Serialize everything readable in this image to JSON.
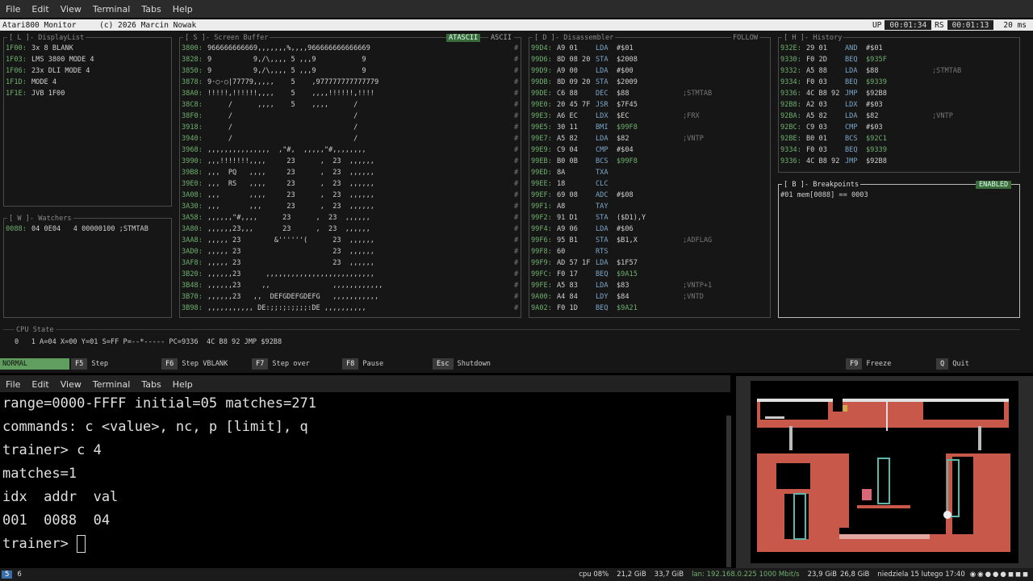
{
  "top_menu": [
    "File",
    "Edit",
    "View",
    "Terminal",
    "Tabs",
    "Help"
  ],
  "title": {
    "app": "Atari800 Monitor",
    "copyright": "(c) 2026 Marcin Nowak",
    "up_label": "UP",
    "up_value": "00:01:34",
    "rs_label": "RS",
    "rs_value": "00:01:13",
    "ms": "20 ms"
  },
  "displaylist": {
    "title": "[ L ]- DisplayList",
    "rows": [
      [
        "1F00:",
        "3x 8 BLANK"
      ],
      [
        "1F03:",
        "LMS 3800 MODE 4"
      ],
      [
        "1F06:",
        "23x DLI MODE 4"
      ],
      [
        "1F1D:",
        "MODE 4"
      ],
      [
        "1F1E:",
        "JVB 1F00"
      ]
    ]
  },
  "watchers": {
    "title": "[ W ]- Watchers",
    "rows": [
      [
        "0088:",
        "04 0E04   4 00000100 ;STMTAB"
      ]
    ]
  },
  "screen": {
    "title": "[ S ]- Screen Buffer",
    "tab_active": "ATASCII",
    "tab_other": "ASCII",
    "rows": [
      [
        "3800:",
        "966666666669,,,,,,,%,,,,966666666666669"
      ],
      [
        "3828:",
        "9          9,/\\,,,, 5 ,,,9           9"
      ],
      [
        "3850:",
        "9          9,/\\,,,, 5 ,,,9           9"
      ],
      [
        "3878:",
        "9·○·○|77779,,,,,    5    ,977777777777779"
      ],
      [
        "38A0:",
        "!!!!!,!!!!!!,,,,    5    ,,,,!!!!!!,!!!!"
      ],
      [
        "38C8:",
        "     /      ,,,,    5    ,,,,      /"
      ],
      [
        "38F0:",
        "     /                             /"
      ],
      [
        "3918:",
        "     /                             /"
      ],
      [
        "3940:",
        "     /                             /"
      ],
      [
        "3968:",
        ",,,,,,,,,,,,,,,  ,\"#,  ,,,,,\"#,,,,,,,,"
      ],
      [
        "3990:",
        ",,,!!!!!!!,,,,     23      ,  23  ,,,,,,"
      ],
      [
        "39B8:",
        ",,,  PQ   ,,,,     23      ,  23  ,,,,,,"
      ],
      [
        "39E0:",
        ",,,  RS   ,,,,     23      ,  23  ,,,,,,"
      ],
      [
        "3A08:",
        ",,,       ,,,,     23      ,  23  ,,,,,,"
      ],
      [
        "3A30:",
        ",,,       ,,,      23      ,  23  ,,,,,,"
      ],
      [
        "3A58:",
        ",,,,,,\"#,,,,      23      ,  23  ,,,,,,"
      ],
      [
        "3A80:",
        ",,,,,,23,,,       23      ,  23  ,,,,,,"
      ],
      [
        "3AA8:",
        ",,,,, 23        &''''''(      23  ,,,,,,"
      ],
      [
        "3AD0:",
        ",,,,, 23                      23  ,,,,,,"
      ],
      [
        "3AF8:",
        ",,,,, 23                      23  ,,,,,,"
      ],
      [
        "3B20:",
        ",,,,,,23      ,,,,,,,,,,,,,,,,,,,,,,,,,,"
      ],
      [
        "3B48:",
        ",,,,,,23     ,,               ,,,,,,,,,,,,"
      ],
      [
        "3B70:",
        ",,,,,,23   ,,  DEFGDEFGDEFG   ,,,,,,,,,,,"
      ],
      [
        "3B98:",
        ",,,,,,,,,,, DE:;;:;:;;;;:DE ,,,,,,,,,,"
      ]
    ]
  },
  "disasm": {
    "title": "[ D ]- Disassembler",
    "follow": "FOLLOW",
    "rows": [
      [
        "99D4:",
        "A9 01",
        "LDA",
        "#$01",
        ""
      ],
      [
        "99D6:",
        "8D 08 20",
        "STA",
        "$2008",
        ""
      ],
      [
        "99D9:",
        "A9 00",
        "LDA",
        "#$00",
        ""
      ],
      [
        "99DB:",
        "8D 09 20",
        "STA",
        "$2009",
        ""
      ],
      [
        "99DE:",
        "C6 88",
        "DEC",
        "$88",
        ";STMTAB"
      ],
      [
        "99E0:",
        "20 45 7F",
        "JSR",
        "$7F45",
        ""
      ],
      [
        "99E3:",
        "A6 EC",
        "LDX",
        "$EC",
        ";FRX"
      ],
      [
        "99E5:",
        "30 11",
        "BMI",
        "$99F8",
        ""
      ],
      [
        "99E7:",
        "A5 82",
        "LDA",
        "$82",
        ";VNTP"
      ],
      [
        "99E9:",
        "C9 04",
        "CMP",
        "#$04",
        ""
      ],
      [
        "99EB:",
        "B0 0B",
        "BCS",
        "$99F8",
        ""
      ],
      [
        "99ED:",
        "8A",
        "TXA",
        "",
        ""
      ],
      [
        "99EE:",
        "18",
        "CLC",
        "",
        ""
      ],
      [
        "99EF:",
        "69 08",
        "ADC",
        "#$08",
        ""
      ],
      [
        "99F1:",
        "A8",
        "TAY",
        "",
        ""
      ],
      [
        "99F2:",
        "91 D1",
        "STA",
        "($D1),Y",
        ""
      ],
      [
        "99F4:",
        "A9 06",
        "LDA",
        "#$06",
        ""
      ],
      [
        "99F6:",
        "95 B1",
        "STA",
        "$B1,X",
        ";ADFLAG"
      ],
      [
        "99F8:",
        "60",
        "RTS",
        "",
        ""
      ],
      [
        "99F9:",
        "AD 57 1F",
        "LDA",
        "$1F57",
        ""
      ],
      [
        "99FC:",
        "F0 17",
        "BEQ",
        "$9A15",
        ""
      ],
      [
        "99FE:",
        "A5 83",
        "LDA",
        "$83",
        ";VNTP+1"
      ],
      [
        "9A00:",
        "A4 84",
        "LDY",
        "$84",
        ";VNTD"
      ],
      [
        "9A02:",
        "F0 1D",
        "BEQ",
        "$9A21",
        ""
      ]
    ]
  },
  "history": {
    "title": "[ H ]- History",
    "rows": [
      [
        "932E:",
        "29 01",
        "AND",
        "#$01",
        ""
      ],
      [
        "9330:",
        "F0 2D",
        "BEQ",
        "$935F",
        ""
      ],
      [
        "9332:",
        "A5 88",
        "LDA",
        "$88",
        ";STMTAB"
      ],
      [
        "9334:",
        "F0 03",
        "BEQ",
        "$9339",
        ""
      ],
      [
        "9336:",
        "4C B8 92",
        "JMP",
        "$92B8",
        ""
      ],
      [
        "92B8:",
        "A2 03",
        "LDX",
        "#$03",
        ""
      ],
      [
        "92BA:",
        "A5 82",
        "LDA",
        "$82",
        ";VNTP"
      ],
      [
        "92BC:",
        "C9 03",
        "CMP",
        "#$03",
        ""
      ],
      [
        "92BE:",
        "B0 01",
        "BCS",
        "$92C1",
        ""
      ],
      [
        "9334:",
        "F0 03",
        "BEQ",
        "$9339",
        ""
      ],
      [
        "9336:",
        "4C B8 92",
        "JMP",
        "$92B8",
        ""
      ]
    ]
  },
  "breakpoints": {
    "title": "[ B ]- Breakpoints",
    "status": "ENABLED",
    "rows": [
      "#01 mem[0088] == 0003"
    ]
  },
  "cpu": {
    "title": "CPU State",
    "line": "0   1 A=04 X=00 Y=01 S=FF P=--*----- PC=9336  4C B8 92 JMP $92B8"
  },
  "keys": {
    "mode": "NORMAL",
    "items": [
      [
        "F5",
        "Step"
      ],
      [
        "F6",
        "Step VBLANK"
      ],
      [
        "F7",
        "Step over"
      ],
      [
        "F8",
        "Pause"
      ],
      [
        "Esc",
        "Shutdown"
      ],
      [
        "F9",
        "Freeze"
      ],
      [
        "Q",
        "Quit"
      ]
    ]
  },
  "trainer_menu": [
    "File",
    "Edit",
    "View",
    "Terminal",
    "Tabs",
    "Help"
  ],
  "trainer": [
    "range=0000-FFFF initial=05 matches=271",
    "commands: c <value>, nc, p [limit], q",
    "trainer> c 4",
    "matches=1",
    "idx  addr  val",
    "001  0088  04",
    "trainer> "
  ],
  "taskbar": {
    "workspace_active": "5",
    "workspace_other": "6",
    "cpu": "cpu  08%",
    "mem1": "21,2 GiB",
    "mem2": "33,7 GiB",
    "lan": "lan: 192.168.0.225 1000 Mbit/s",
    "disk": "23,9 GiB",
    "disk2": "26,8 GiB",
    "date": "niedziela 15 lutego 17:40"
  },
  "colors": {
    "accent_green": "#5f9e5f",
    "addr": "#6fb06f",
    "dim": "#777777"
  }
}
